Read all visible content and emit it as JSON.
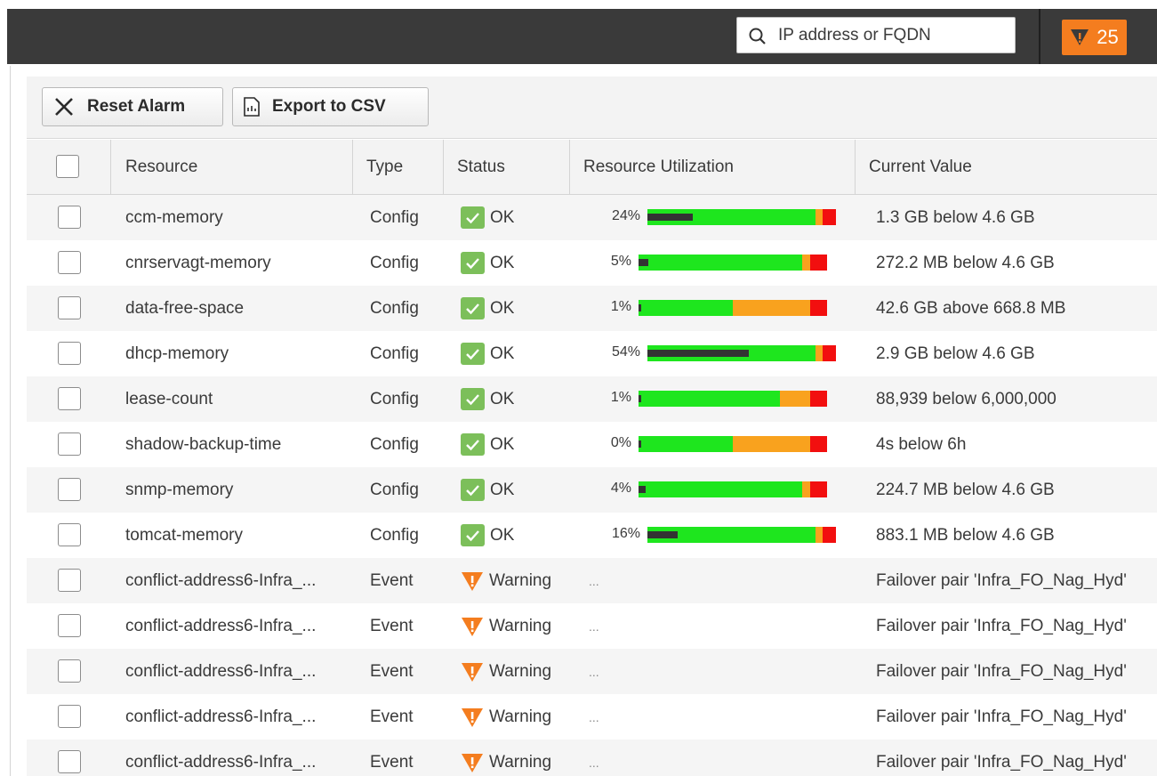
{
  "search": {
    "placeholder": "IP address or FQDN"
  },
  "alarm_count": "25",
  "toolbar": {
    "reset_label": "Reset Alarm",
    "export_label": "Export to CSV"
  },
  "columns": {
    "resource": "Resource",
    "type": "Type",
    "status": "Status",
    "utilization": "Resource Utilization",
    "value": "Current Value"
  },
  "colors": {
    "ok": "#7cbf5a",
    "warning": "#f47d1f",
    "green_bar": "#1ee61e",
    "orange_bar": "#f9a21e",
    "red_bar": "#f20f0f"
  },
  "rows": [
    {
      "resource": "ccm-memory",
      "type": "Config",
      "status": "OK",
      "utilization": "24%",
      "used": 0.24,
      "green_end": 0.89,
      "orange_end": 0.93,
      "value": "1.3 GB below 4.6 GB"
    },
    {
      "resource": "cnrservagt-memory",
      "type": "Config",
      "status": "OK",
      "utilization": "5%",
      "used": 0.05,
      "green_end": 0.87,
      "orange_end": 0.91,
      "value": "272.2 MB below 4.6 GB"
    },
    {
      "resource": "data-free-space",
      "type": "Config",
      "status": "OK",
      "utilization": "1%",
      "used": 0.01,
      "green_end": 0.5,
      "orange_end": 0.91,
      "value": "42.6 GB above 668.8 MB"
    },
    {
      "resource": "dhcp-memory",
      "type": "Config",
      "status": "OK",
      "utilization": "54%",
      "used": 0.54,
      "green_end": 0.89,
      "orange_end": 0.93,
      "value": "2.9 GB below 4.6 GB"
    },
    {
      "resource": "lease-count",
      "type": "Config",
      "status": "OK",
      "utilization": "1%",
      "used": 0.01,
      "green_end": 0.75,
      "orange_end": 0.91,
      "value": "88,939 below 6,000,000"
    },
    {
      "resource": "shadow-backup-time",
      "type": "Config",
      "status": "OK",
      "utilization": "0%",
      "used": 0.0,
      "green_end": 0.5,
      "orange_end": 0.91,
      "value": "4s below 6h"
    },
    {
      "resource": "snmp-memory",
      "type": "Config",
      "status": "OK",
      "utilization": "4%",
      "used": 0.04,
      "green_end": 0.87,
      "orange_end": 0.91,
      "value": "224.7 MB below 4.6 GB"
    },
    {
      "resource": "tomcat-memory",
      "type": "Config",
      "status": "OK",
      "utilization": "16%",
      "used": 0.16,
      "green_end": 0.89,
      "orange_end": 0.93,
      "value": "883.1 MB below 4.6 GB"
    },
    {
      "resource": "conflict-address6-Infra_...",
      "type": "Event",
      "status": "Warning",
      "utilization": "...",
      "value": "Failover pair 'Infra_FO_Nag_Hyd'"
    },
    {
      "resource": "conflict-address6-Infra_...",
      "type": "Event",
      "status": "Warning",
      "utilization": "...",
      "value": "Failover pair 'Infra_FO_Nag_Hyd'"
    },
    {
      "resource": "conflict-address6-Infra_...",
      "type": "Event",
      "status": "Warning",
      "utilization": "...",
      "value": "Failover pair 'Infra_FO_Nag_Hyd'"
    },
    {
      "resource": "conflict-address6-Infra_...",
      "type": "Event",
      "status": "Warning",
      "utilization": "...",
      "value": "Failover pair 'Infra_FO_Nag_Hyd'"
    },
    {
      "resource": "conflict-address6-Infra_...",
      "type": "Event",
      "status": "Warning",
      "utilization": "...",
      "value": "Failover pair 'Infra_FO_Nag_Hyd'"
    }
  ]
}
